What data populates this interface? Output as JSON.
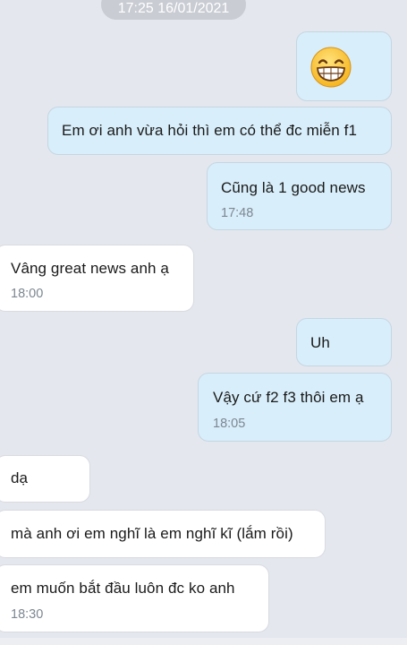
{
  "date_pill": "17:25 16/01/2021",
  "emoji": "grinning-face-emoji",
  "messages": [
    {
      "text": "Em ơi anh vừa hỏi thì em có thể đc miễn f1"
    },
    {
      "text": "Cũng là 1 good news",
      "time": "17:48"
    },
    {
      "text": "Vâng great news anh ạ",
      "time": "18:00"
    },
    {
      "text": "Uh"
    },
    {
      "text": "Vậy cứ f2 f3 thôi em ạ",
      "time": "18:05"
    },
    {
      "text": "dạ"
    },
    {
      "text": "mà anh ơi em nghĩ là em nghĩ kĩ (lắm rồi)"
    },
    {
      "text": "em muốn bắt đầu luôn đc ko anh",
      "time": "18:30"
    }
  ],
  "colors": {
    "background": "#e4e7ee",
    "outgoing_bubble": "#d8eefa",
    "incoming_bubble": "#ffffff",
    "time_text": "#7d8791"
  }
}
